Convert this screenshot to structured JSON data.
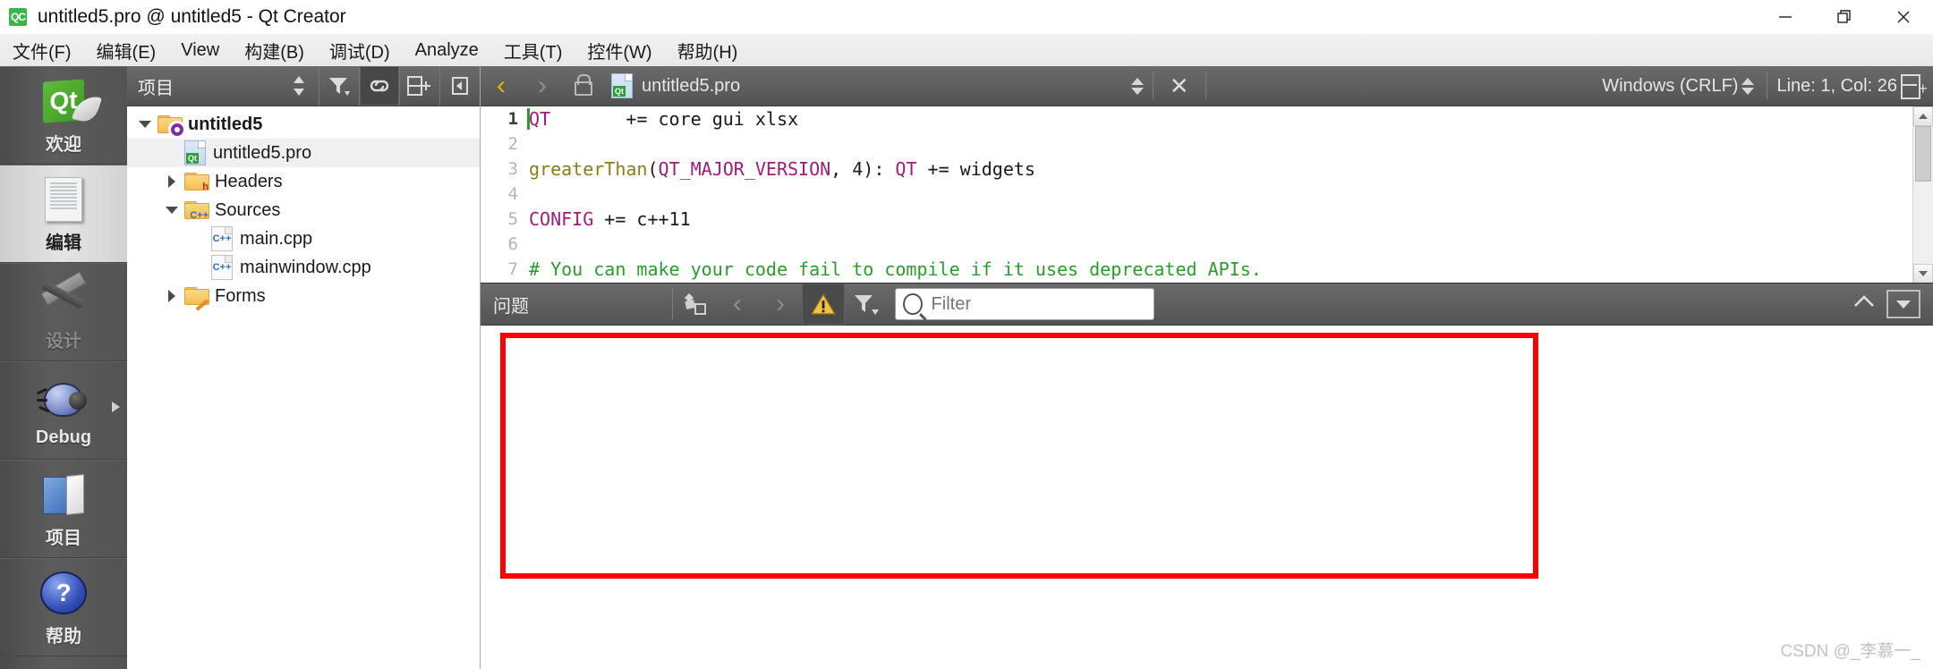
{
  "window": {
    "title": "untitled5.pro @ untitled5 - Qt Creator",
    "app_icon": "qt-creator-icon",
    "minimize_label": "—",
    "maximize_label": "❐",
    "close_label": "✕"
  },
  "menu": {
    "items": [
      {
        "label": "文件(F)",
        "name": "menu-file"
      },
      {
        "label": "编辑(E)",
        "name": "menu-edit"
      },
      {
        "label": "View",
        "name": "menu-view"
      },
      {
        "label": "构建(B)",
        "name": "menu-build"
      },
      {
        "label": "调试(D)",
        "name": "menu-debug"
      },
      {
        "label": "Analyze",
        "name": "menu-analyze"
      },
      {
        "label": "工具(T)",
        "name": "menu-tools"
      },
      {
        "label": "控件(W)",
        "name": "menu-window"
      },
      {
        "label": "帮助(H)",
        "name": "menu-help"
      }
    ]
  },
  "modebar": {
    "items": [
      {
        "label": "欢迎",
        "icon": "qt-logo-icon",
        "state": "normal"
      },
      {
        "label": "编辑",
        "icon": "document-icon",
        "state": "selected"
      },
      {
        "label": "设计",
        "icon": "design-tools-icon",
        "state": "disabled"
      },
      {
        "label": "Debug",
        "icon": "bug-icon",
        "state": "normal"
      },
      {
        "label": "项目",
        "icon": "projects-folder-icon",
        "state": "normal"
      },
      {
        "label": "帮助",
        "icon": "question-mark-icon",
        "state": "normal"
      }
    ]
  },
  "project_panel": {
    "title": "项目",
    "header_buttons": [
      {
        "name": "selector-updown-icon",
        "glyph": "↕"
      },
      {
        "name": "filter-icon",
        "glyph": "filter"
      },
      {
        "name": "link-with-editor-icon",
        "glyph": "link"
      },
      {
        "name": "split-add-icon",
        "glyph": "split"
      },
      {
        "name": "collapse-sidebar-icon",
        "glyph": "collapse"
      }
    ],
    "tree": [
      {
        "label": "untitled5",
        "icon": "project-folder-gear-icon",
        "indent": 0,
        "twisty": "down",
        "bold": true,
        "selected": false
      },
      {
        "label": "untitled5.pro",
        "icon": "qt-pro-file-icon",
        "indent": 1,
        "twisty": "none",
        "bold": false,
        "selected": true
      },
      {
        "label": "Headers",
        "icon": "folder-h-icon",
        "indent": 1,
        "twisty": "right",
        "bold": false,
        "selected": false
      },
      {
        "label": "Sources",
        "icon": "folder-cpp-icon",
        "indent": 1,
        "twisty": "down",
        "bold": false,
        "selected": false
      },
      {
        "label": "main.cpp",
        "icon": "cpp-file-icon",
        "indent": 2,
        "twisty": "none",
        "bold": false,
        "selected": false
      },
      {
        "label": "mainwindow.cpp",
        "icon": "cpp-file-icon",
        "indent": 2,
        "twisty": "none",
        "bold": false,
        "selected": false
      },
      {
        "label": "Forms",
        "icon": "folder-forms-icon",
        "indent": 1,
        "twisty": "right",
        "bold": false,
        "selected": false
      }
    ]
  },
  "editor_toolbar": {
    "back_label": "‹",
    "forward_label": "›",
    "lock_name": "unlocked-icon",
    "file_icon": "qt-pro-file-icon",
    "file_name": "untitled5.pro",
    "close_label": "✕",
    "line_ending": "Windows (CRLF)",
    "cursor_position": "Line: 1, Col: 26",
    "split_name": "split-editor-icon"
  },
  "code": {
    "language": "qmake",
    "lines": [
      {
        "num": "1",
        "current": true,
        "tokens": [
          {
            "t": "QT       ",
            "c": "tok-var"
          },
          {
            "t": "+= core gui xlsx",
            "c": ""
          }
        ]
      },
      {
        "num": "2",
        "current": false,
        "tokens": [
          {
            "t": "",
            "c": ""
          }
        ]
      },
      {
        "num": "3",
        "current": false,
        "tokens": [
          {
            "t": "greaterThan",
            "c": "tok-fn"
          },
          {
            "t": "(",
            "c": ""
          },
          {
            "t": "QT_MAJOR_VERSION",
            "c": "tok-var"
          },
          {
            "t": ", 4): ",
            "c": ""
          },
          {
            "t": "QT",
            "c": "tok-var"
          },
          {
            "t": " += widgets",
            "c": ""
          }
        ]
      },
      {
        "num": "4",
        "current": false,
        "tokens": [
          {
            "t": "",
            "c": ""
          }
        ]
      },
      {
        "num": "5",
        "current": false,
        "tokens": [
          {
            "t": "CONFIG",
            "c": "tok-var"
          },
          {
            "t": " += c++11",
            "c": ""
          }
        ]
      },
      {
        "num": "6",
        "current": false,
        "tokens": [
          {
            "t": "",
            "c": ""
          }
        ]
      },
      {
        "num": "7",
        "current": false,
        "tokens": [
          {
            "t": "# You can make your code fail to compile if it uses deprecated APIs.",
            "c": "tok-comment"
          }
        ]
      }
    ]
  },
  "issues_panel": {
    "title": "问题",
    "buttons": [
      {
        "name": "clear-issues-icon",
        "glyph": "broom"
      },
      {
        "name": "previous-issue-icon",
        "glyph": "‹"
      },
      {
        "name": "next-issue-icon",
        "glyph": "›"
      },
      {
        "name": "warning-filter-icon",
        "glyph": "warning"
      },
      {
        "name": "filter-dropdown-icon",
        "glyph": "funnel"
      }
    ],
    "filter_placeholder": "Filter",
    "filter_value": "",
    "collapse_label": "⌃",
    "maximize_name": "output-pane-toggle-icon",
    "content_rows": []
  },
  "annotation": {
    "type": "red-rectangle-highlight",
    "color": "#ff0000"
  },
  "watermark": {
    "text": "CSDN @_李慕一_"
  }
}
